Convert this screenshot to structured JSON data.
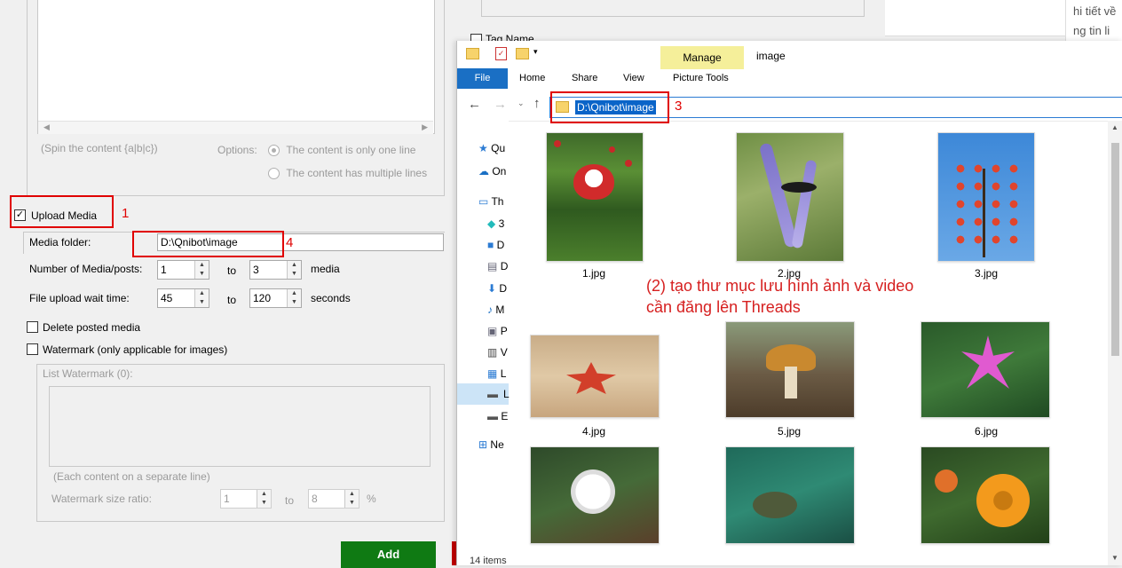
{
  "form": {
    "spin_hint": "(Spin the content {a|b|c})",
    "options_label": "Options:",
    "option_one_line": "The content is only one line",
    "option_multi_line": "The content has multiple lines",
    "upload_media_label": "Upload Media",
    "annot_1": "1",
    "media_folder_label": "Media folder:",
    "media_folder_value": "D:\\Qnibot\\image",
    "annot_4": "4",
    "num_media_label": "Number of Media/posts:",
    "num_media_from": "1",
    "to_label": "to",
    "num_media_to": "3",
    "media_unit": "media",
    "wait_label": "File upload wait time:",
    "wait_from": "45",
    "wait_to": "120",
    "seconds_unit": "seconds",
    "delete_posted_label": "Delete posted media",
    "watermark_label": "Watermark (only applicable for images)",
    "list_watermark_label": "List Watermark (0):",
    "each_content_hint": "(Each content on a separate line)",
    "watermark_ratio_label": "Watermark size ratio:",
    "ratio_from": "1",
    "ratio_to": "8",
    "percent": "%",
    "add_button": "Add"
  },
  "background": {
    "tag_name_label": "Tag Name",
    "right_text_1": "hi tiết về",
    "right_text_2": "ng tin li"
  },
  "explorer": {
    "manage_tab": "Manage",
    "window_title": "image",
    "tabs": [
      "File",
      "Home",
      "Share",
      "View",
      "Picture Tools"
    ],
    "address": "D:\\Qnibot\\image",
    "annot_3": "3",
    "nav_items": [
      "Qu",
      "On",
      "Th",
      "3",
      "D",
      "D",
      "D",
      "M",
      "P",
      "V",
      "L",
      "L",
      "E",
      "Ne"
    ],
    "files": [
      "1.jpg",
      "2.jpg",
      "3.jpg",
      "4.jpg",
      "5.jpg",
      "6.jpg"
    ],
    "annotation_line1": "(2) tạo thư mục lưu hình ảnh và video",
    "annotation_line2": "cần đăng lên Threads",
    "status": "14 items"
  },
  "colors": {
    "add_button_bg": "#0f7a13",
    "annotation_red": "#e00000",
    "manage_tab_bg": "#f5ef9a",
    "file_tab_bg": "#1a6fc4",
    "address_selection": "#0a64c8"
  }
}
